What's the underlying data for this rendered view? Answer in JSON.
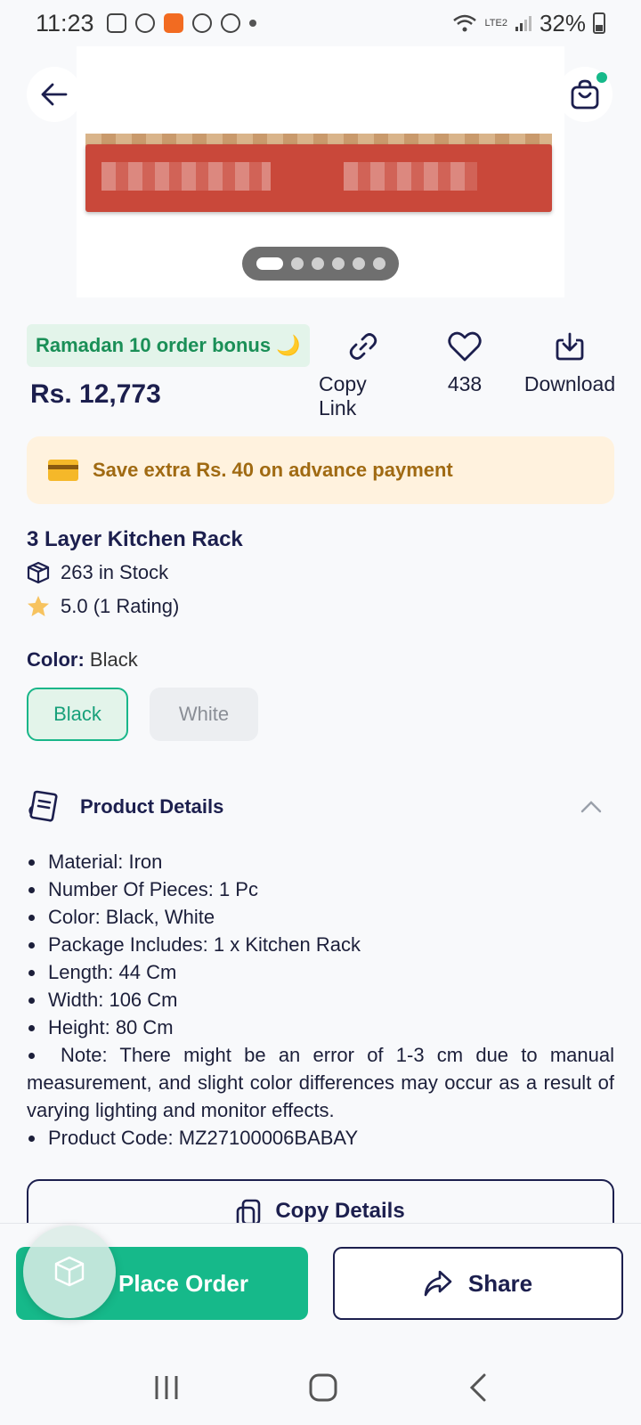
{
  "status_bar": {
    "time": "11:23",
    "network": "LTE2",
    "battery": "32%"
  },
  "promo_badge": "Ramadan 10 order bonus 🌙",
  "price": "Rs. 12,773",
  "actions": {
    "copy_link": "Copy Link",
    "favorites_count": "438",
    "download": "Download"
  },
  "save_banner": "Save extra Rs. 40 on advance payment",
  "product": {
    "title": "3 Layer Kitchen Rack",
    "stock": "263 in Stock",
    "rating": "5.0 (1 Rating)"
  },
  "color": {
    "label": "Color:",
    "selected": "Black",
    "options": [
      "Black",
      "White"
    ]
  },
  "details": {
    "title": "Product Details",
    "items": [
      "Material: Iron",
      "Number Of Pieces: 1 Pc",
      "Color: Black, White",
      "Package Includes: 1 x Kitchen Rack",
      "Length: 44 Cm",
      "Width: 106 Cm",
      "Height: 80 Cm",
      "Note: There might be an error of 1-3 cm due to manual measurement, and slight color differences may occur as a result of varying lighting and monitor effects.",
      "Product Code: MZ27100006BABAY"
    ],
    "copy_button": "Copy Details"
  },
  "bottom": {
    "place_order": "Place Order",
    "share": "Share"
  },
  "colors": {
    "accent": "#16b98a",
    "navy": "#1c1f4e",
    "banner_bg": "#fff2de",
    "banner_text": "#a06a12"
  }
}
